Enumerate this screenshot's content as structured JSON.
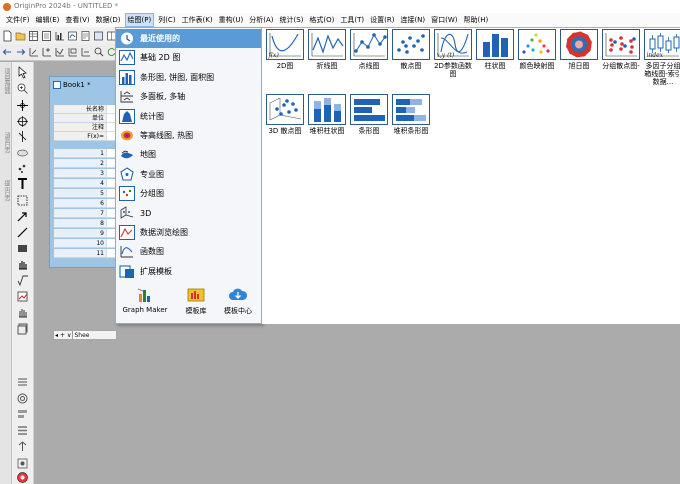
{
  "app": {
    "title": "OriginPro 2024b - UNTITLED *"
  },
  "menubar": [
    {
      "label": "文件(F)"
    },
    {
      "label": "编辑(E)"
    },
    {
      "label": "查看(V)"
    },
    {
      "label": "数据(D)"
    },
    {
      "label": "绘图(P)",
      "active": true
    },
    {
      "label": "列(C)"
    },
    {
      "label": "工作表(K)"
    },
    {
      "label": "重构(U)"
    },
    {
      "label": "分析(A)"
    },
    {
      "label": "统计(S)"
    },
    {
      "label": "格式(O)"
    },
    {
      "label": "工具(T)"
    },
    {
      "label": "设置(R)"
    },
    {
      "label": "连接(N)"
    },
    {
      "label": "窗口(W)"
    },
    {
      "label": "帮助(H)"
    }
  ],
  "left_panels": {
    "project_explorer": "项目管理器",
    "messages": "消息日志",
    "hint": "提示日志"
  },
  "book": {
    "title": "Book1 *",
    "meta_rows": [
      "长名称",
      "单位",
      "注释",
      "F(x)="
    ],
    "rows": [
      "1",
      "2",
      "3",
      "4",
      "5",
      "6",
      "7",
      "8",
      "9",
      "10",
      "11"
    ],
    "sheet_tab": "Shee",
    "nav_buttons": [
      "◂",
      "+",
      "∨"
    ]
  },
  "plot_menu": {
    "items": [
      {
        "label": "最近使用的",
        "icon": "recent-icon",
        "selected": true
      },
      {
        "label": "基础 2D 图",
        "icon": "line-plot-icon"
      },
      {
        "label": "条形图, 饼图, 面积图",
        "icon": "bar-plot-icon"
      },
      {
        "label": "多面板, 多轴",
        "icon": "multi-panel-icon"
      },
      {
        "label": "统计图",
        "icon": "statistics-icon"
      },
      {
        "label": "等高线图, 热图",
        "icon": "contour-icon"
      },
      {
        "label": "地图",
        "icon": "map-icon"
      },
      {
        "label": "专业图",
        "icon": "specialized-icon"
      },
      {
        "label": "分组图",
        "icon": "grouped-icon"
      },
      {
        "label": "3D",
        "icon": "3d-icon"
      },
      {
        "label": "数据浏览绘图",
        "icon": "data-explore-icon"
      },
      {
        "label": "函数图",
        "icon": "function-icon"
      },
      {
        "label": "扩展模板",
        "icon": "extension-icon"
      }
    ],
    "bottom": [
      {
        "label": "Graph Maker",
        "icon": "graph-maker-icon"
      },
      {
        "label": "模板库",
        "icon": "template-library-icon"
      },
      {
        "label": "模板中心",
        "icon": "template-center-icon"
      }
    ]
  },
  "gallery": {
    "items": [
      {
        "label": "2D图",
        "kind": "func",
        "overlay": "f(x)"
      },
      {
        "label": "折线图",
        "kind": "line"
      },
      {
        "label": "点线图",
        "kind": "linesym"
      },
      {
        "label": "散点图",
        "kind": "scatter"
      },
      {
        "label": "2D参数函数图",
        "kind": "param",
        "overlay": "x,y (t)"
      },
      {
        "label": "柱状图",
        "kind": "column"
      },
      {
        "label": "颜色映射图",
        "kind": "colormap"
      },
      {
        "label": "旭日图",
        "kind": "sunburst"
      },
      {
        "label": "分组散点图-",
        "kind": "groupscatter"
      },
      {
        "label": "多因子分组箱线图-索引数据...",
        "kind": "box",
        "overlay": "index"
      },
      {
        "label": "3D 散点图",
        "kind": "scatter3d"
      },
      {
        "label": "堆积柱状图",
        "kind": "stackcol"
      },
      {
        "label": "条形图",
        "kind": "bar"
      },
      {
        "label": "堆积条形图",
        "kind": "stackbar"
      }
    ]
  },
  "colors": {
    "menu_selected": "#5b9bd5",
    "chart_blue": "#1f63b5",
    "workspace": "#ababab"
  }
}
